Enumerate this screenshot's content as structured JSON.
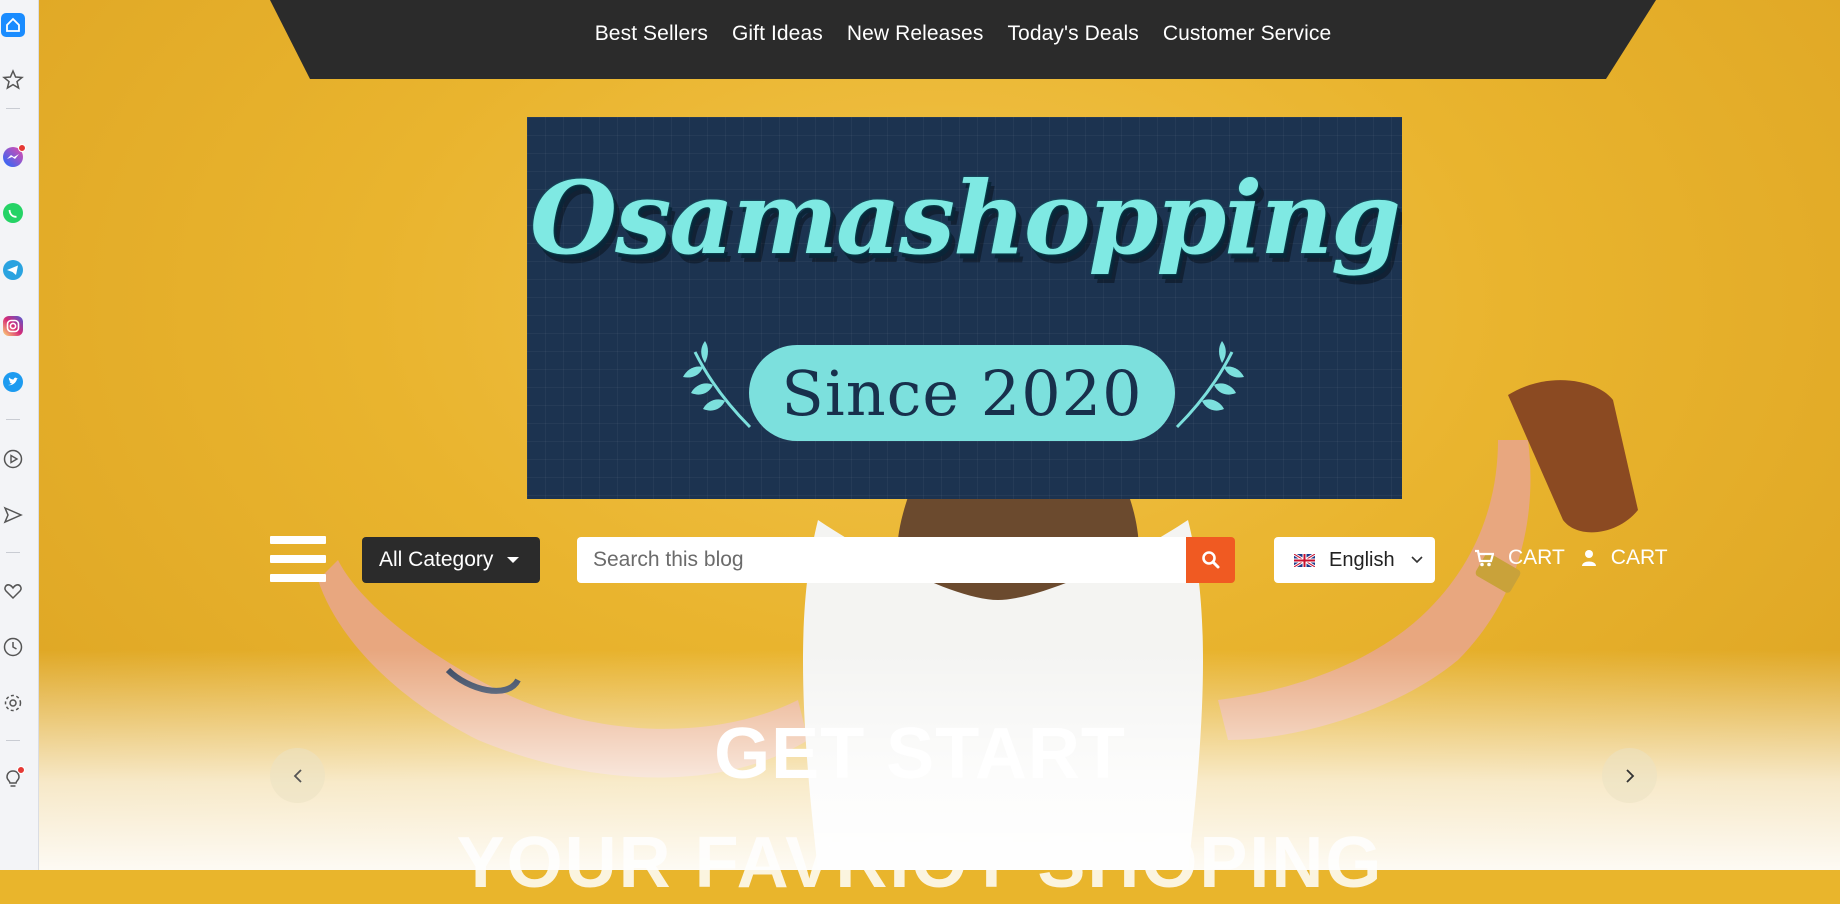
{
  "browser_sidebar": {
    "icons": [
      "home-icon",
      "star-icon",
      "messenger-icon",
      "whatsapp-icon",
      "telegram-icon",
      "instagram-icon",
      "twitter-icon",
      "player-icon",
      "send-icon",
      "heart-icon",
      "clock-icon",
      "gear-icon",
      "lightbulb-icon"
    ]
  },
  "top_nav": {
    "links": [
      "Best Sellers",
      "Gift Ideas",
      "New Releases",
      "Today's Deals",
      "Customer Service"
    ]
  },
  "logo": {
    "title": "Osamashopping",
    "subtitle": "Since 2020"
  },
  "search_row": {
    "category_label": "All Category",
    "search_placeholder": "Search this blog",
    "language": "English",
    "cart_label": "CART",
    "account_label": "CART"
  },
  "hero": {
    "heading": "GET START",
    "subheading": "YOUR FAVRIOT SHOPING"
  },
  "colors": {
    "accent": "#f05a22",
    "nav_bg": "#2b2b2b",
    "logo_bg": "#1c3350",
    "logo_text": "#7fe9e3"
  }
}
